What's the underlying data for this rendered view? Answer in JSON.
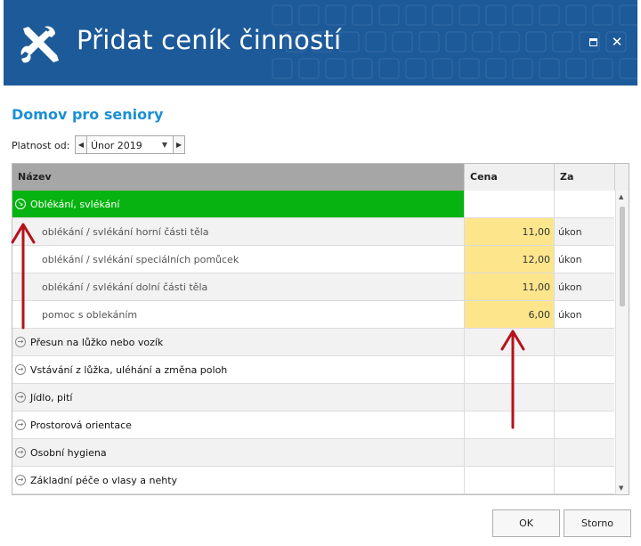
{
  "window": {
    "title": "Přidat ceník činností",
    "close_glyph": "✕"
  },
  "organization": "Domov pro seniory",
  "validity": {
    "label": "Platnost od:",
    "value": "Únor 2019",
    "prev_glyph": "◀",
    "next_glyph": "▶",
    "drop_glyph": "▼"
  },
  "grid": {
    "columns": {
      "name": "Název",
      "price": "Cena",
      "unit": "Za"
    },
    "rows": [
      {
        "type": "group",
        "name": "Oblékání, svlékání",
        "price": "",
        "unit": "",
        "expanded": true,
        "selected": true
      },
      {
        "type": "child",
        "name": "oblékání / svlékání horní části těla",
        "price": "11,00",
        "unit": "úkon"
      },
      {
        "type": "child",
        "name": "oblékání / svlékání speciálních pomůcek",
        "price": "12,00",
        "unit": "úkon"
      },
      {
        "type": "child",
        "name": "oblékání / svlékání dolní části těla",
        "price": "11,00",
        "unit": "úkon"
      },
      {
        "type": "child",
        "name": "pomoc s oblekáním",
        "price": "6,00",
        "unit": "úkon"
      },
      {
        "type": "group",
        "name": "Přesun na lůžko nebo vozík",
        "price": "",
        "unit": ""
      },
      {
        "type": "group",
        "name": "Vstávání z lůžka, uléhání a změna poloh",
        "price": "",
        "unit": ""
      },
      {
        "type": "group",
        "name": "Jídlo, pití",
        "price": "",
        "unit": ""
      },
      {
        "type": "group",
        "name": "Prostorová orientace",
        "price": "",
        "unit": ""
      },
      {
        "type": "group",
        "name": "Osobní hygiena",
        "price": "",
        "unit": ""
      },
      {
        "type": "group",
        "name": "Základní péče o vlasy a nehty",
        "price": "",
        "unit": ""
      }
    ]
  },
  "buttons": {
    "ok": "OK",
    "cancel": "Storno"
  },
  "colors": {
    "titlebar": "#1d5a99",
    "accent_text": "#1b8fd4",
    "selected_row": "#07b311",
    "price_highlight": "#fde58c",
    "annotation_arrow": "#b5121b"
  },
  "icons": {
    "app": "tools-icon",
    "expanded": "circle-arrow-down-icon",
    "collapsed": "circle-arrow-right-icon"
  }
}
